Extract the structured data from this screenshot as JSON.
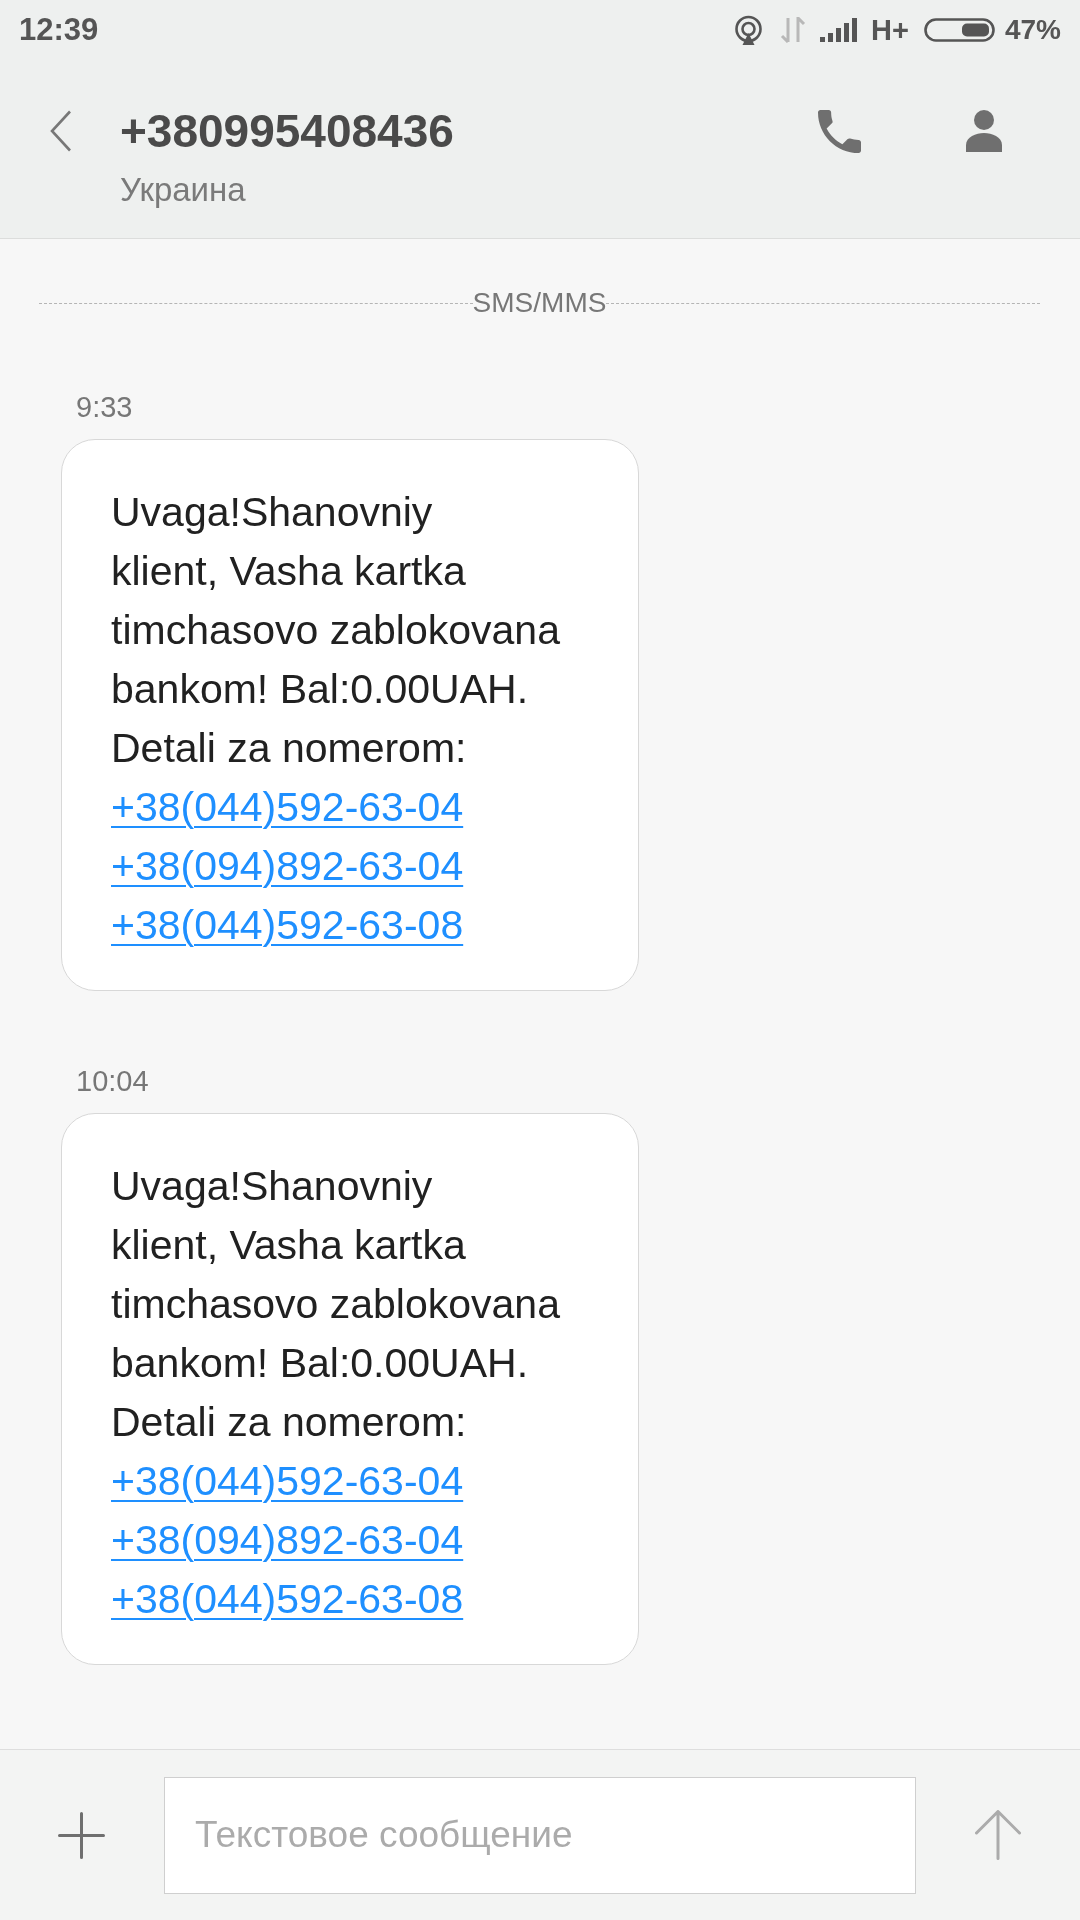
{
  "status_bar": {
    "time": "12:39",
    "network": "H+",
    "battery": "47%"
  },
  "header": {
    "title": "+380995408436",
    "subtitle": "Украина"
  },
  "divider": {
    "label": "SMS/MMS"
  },
  "messages": [
    {
      "time": "9:33",
      "text": "Uvaga!Shanovniy\nklient, Vasha kartka\ntimchasovo zablokovana\nbankom! Bal:0.00UAH.\nDetali za nomerom:",
      "links": [
        "+38(044)592-63-04",
        "+38(094)892-63-04",
        "+38(044)592-63-08"
      ]
    },
    {
      "time": "10:04",
      "text": "Uvaga!Shanovniy\nklient, Vasha kartka\ntimchasovo zablokovana\nbankom! Bal:0.00UAH.\nDetali za nomerom:",
      "links": [
        "+38(044)592-63-04",
        "+38(094)892-63-04",
        "+38(044)592-63-08"
      ]
    }
  ],
  "composer": {
    "placeholder": "Текстовое сообщение"
  }
}
